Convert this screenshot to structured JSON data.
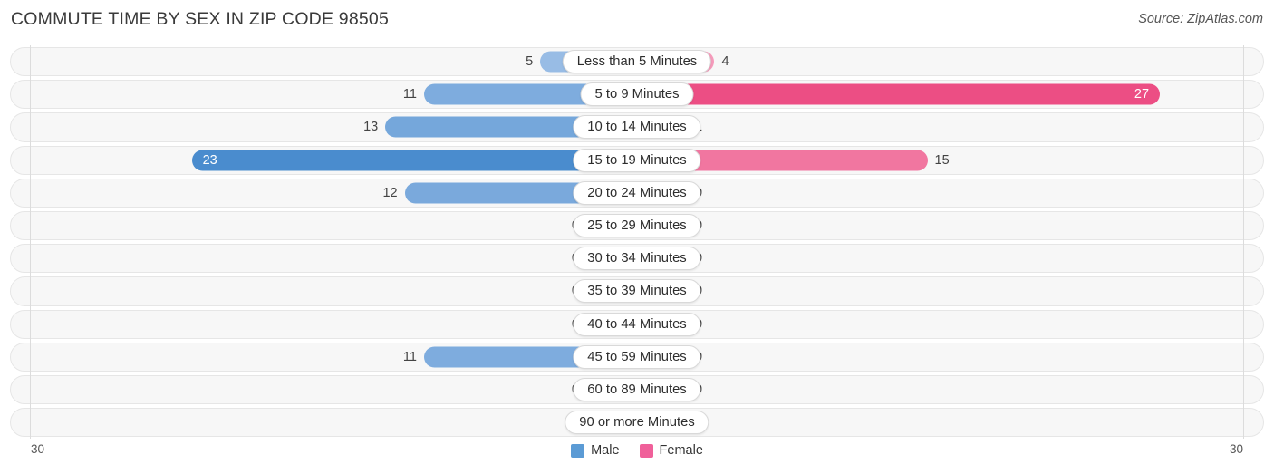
{
  "header": {
    "title": "COMMUTE TIME BY SEX IN ZIP CODE 98505",
    "source": "Source: ZipAtlas.com"
  },
  "legend": {
    "male_label": "Male",
    "female_label": "Female",
    "male_color": "#5B9BD5",
    "female_color": "#F0609A"
  },
  "axis": {
    "left_max": "30",
    "right_max": "30"
  },
  "chart_data": {
    "type": "bar",
    "title": "COMMUTE TIME BY SEX IN ZIP CODE 98505",
    "xlabel": "",
    "ylabel": "",
    "orientation": "horizontal-diverging",
    "xlim": [
      30,
      30
    ],
    "grid": false,
    "legend_position": "bottom-center",
    "categories": [
      "Less than 5 Minutes",
      "5 to 9 Minutes",
      "10 to 14 Minutes",
      "15 to 19 Minutes",
      "20 to 24 Minutes",
      "25 to 29 Minutes",
      "30 to 34 Minutes",
      "35 to 39 Minutes",
      "40 to 44 Minutes",
      "45 to 59 Minutes",
      "60 to 89 Minutes",
      "90 or more Minutes"
    ],
    "series": [
      {
        "name": "Male",
        "side": "left",
        "color": "#5B9BD5",
        "values": [
          5,
          11,
          13,
          23,
          12,
          0,
          0,
          0,
          0,
          11,
          0,
          0
        ]
      },
      {
        "name": "Female",
        "side": "right",
        "color": "#F0609A",
        "values": [
          4,
          27,
          1,
          15,
          0,
          0,
          0,
          0,
          0,
          0,
          0,
          0
        ]
      }
    ]
  }
}
